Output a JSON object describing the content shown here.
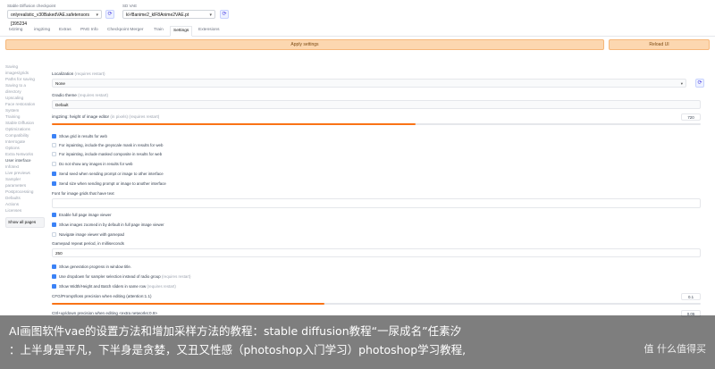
{
  "header": {
    "checkpoint_label": "Stable Diffusion checkpoint",
    "checkpoint_value": "onlyrealistic_v30BakedVAE.safetensors [395234",
    "vae_label": "SD VAE",
    "vae_value": "kl-f8anime2_klF8Anime2VAE.pt"
  },
  "tabs": [
    "txt2img",
    "img2img",
    "Extras",
    "PNG Info",
    "Checkpoint Merger",
    "Train",
    "Settings",
    "Extensions"
  ],
  "active_tab": "Settings",
  "buttons": {
    "apply": "Apply settings",
    "reload": "Reload UI"
  },
  "sidebar": [
    "Saving",
    "images/grids",
    "Paths for saving",
    "Saving to a",
    "directory",
    "Upscaling",
    "Face restoration",
    "System",
    "Training",
    "Stable Diffusion",
    "Optimizations",
    "Compatibility",
    "Interrogate",
    "Options",
    "Extra Networks",
    "User interface",
    "Infotext",
    "Live previews",
    "Sampler",
    "parameters",
    "Postprocessing",
    "Defaults",
    "Actions",
    "Licenses"
  ],
  "sidebar_current": "User interface",
  "sidebar_show_all": "Show all pages",
  "settings": {
    "localization_label": "Localization",
    "localization_note": "(requires restart)",
    "localization_value": "None",
    "gradio_label": "Gradio theme",
    "gradio_note": "(requires restart)",
    "gradio_value": "Default",
    "img2img_label": "img2img: height of image editor",
    "img2img_note": "(in pixels) (requires restart)",
    "img2img_value": "720",
    "img2img_fraction": 0.56,
    "check1": "Show grid in results for web",
    "check2": "For inpainting, include the greyscale mask in results for web",
    "check3": "For inpainting, include masked composite in results for web",
    "check4": "Do not show any images in results for web",
    "check5": "Send seed when sending prompt or image to other interface",
    "check6": "Send size when sending prompt or image to another interface",
    "font_label": "Font for image grids that have text",
    "check7": "Enable full page image viewer",
    "check8": "Show images zoomed in by default in full page image viewer",
    "check9": "Navigate image viewer with gamepad",
    "gamepad_label": "Gamepad repeat period, in milliseconds",
    "gamepad_value": "250",
    "check10": "Show generation progress in window title.",
    "check11": "Use dropdown for sampler selection instead of radio group",
    "check11_note": "(requires restart)",
    "check12": "Show Width/Height and Batch sliders in same row",
    "check12_note": "(requires restart)",
    "cfg_label": "CFG/Prompt/loss precision when editing (attention:1.1)",
    "cfg_value": "0.1",
    "cfg_fraction": 0.42,
    "cfg2_label": "Ctrl+up/down precision when editing <extra networks:0.9>",
    "cfg2_value": "0.05"
  },
  "caption": {
    "line1": "AI画图软件vae的设置方法和增加采样方法的教程：stable diffusion教程“一尿成名”任素汐",
    "line2": "：上半身是平凡，下半身是贪婪，又丑又性感（photoshop入门学习）photoshop学习教程,",
    "watermark": "值 什么值得买"
  }
}
